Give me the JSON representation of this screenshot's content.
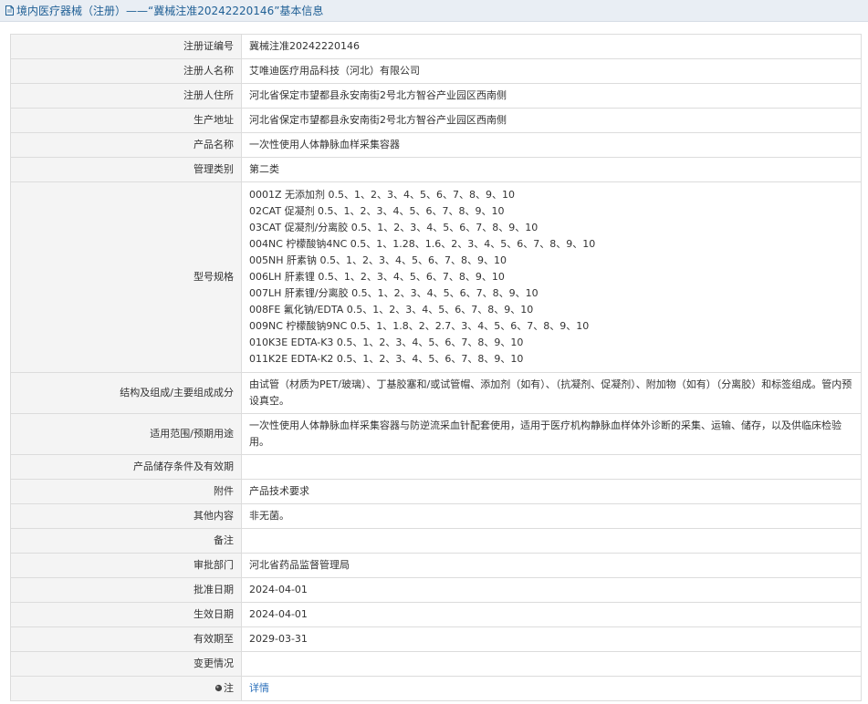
{
  "header": {
    "title": "境内医疗器械（注册）——“冀械注准20242220146”基本信息"
  },
  "rows": [
    {
      "label": "注册证编号",
      "value": "冀械注准20242220146"
    },
    {
      "label": "注册人名称",
      "value": "艾唯迪医疗用品科技（河北）有限公司"
    },
    {
      "label": "注册人住所",
      "value": "河北省保定市望都县永安南街2号北方智谷产业园区西南侧"
    },
    {
      "label": "生产地址",
      "value": "河北省保定市望都县永安南街2号北方智谷产业园区西南侧"
    },
    {
      "label": "产品名称",
      "value": "一次性使用人体静脉血样采集容器"
    },
    {
      "label": "管理类别",
      "value": "第二类"
    }
  ],
  "model": {
    "label": "型号规格",
    "lines": [
      "0001Z 无添加剂 0.5、1、2、3、4、5、6、7、8、9、10",
      "02CAT 促凝剂 0.5、1、2、3、4、5、6、7、8、9、10",
      "03CAT 促凝剂/分离胶 0.5、1、2、3、4、5、6、7、8、9、10",
      "004NC 柠檬酸钠4NC 0.5、1、1.28、1.6、2、3、4、5、6、7、8、9、10",
      "005NH 肝素钠 0.5、1、2、3、4、5、6、7、8、9、10",
      "006LH 肝素锂 0.5、1、2、3、4、5、6、7、8、9、10",
      "007LH 肝素锂/分离胶 0.5、1、2、3、4、5、6、7、8、9、10",
      "008FE 氟化钠/EDTA 0.5、1、2、3、4、5、6、7、8、9、10",
      "009NC 柠檬酸钠9NC 0.5、1、1.8、2、2.7、3、4、5、6、7、8、9、10",
      "010K3E EDTA-K3 0.5、1、2、3、4、5、6、7、8、9、10",
      "011K2E EDTA-K2 0.5、1、2、3、4、5、6、7、8、9、10"
    ]
  },
  "structure": {
    "label": "结构及组成/主要组成成分",
    "value": "由试管（材质为PET/玻璃）、丁基胶塞和/或试管帽、添加剂（如有）、（抗凝剂、促凝剂）、附加物（如有）（分离胶）和标签组成。管内预设真空。"
  },
  "usage": {
    "label": "适用范围/预期用途",
    "value": "一次性使用人体静脉血样采集容器与防逆流采血针配套使用，适用于医疗机构静脉血样体外诊断的采集、运输、储存，以及供临床检验用。"
  },
  "rows2": [
    {
      "label": "产品储存条件及有效期",
      "value": ""
    },
    {
      "label": "附件",
      "value": "产品技术要求"
    },
    {
      "label": "其他内容",
      "value": "非无菌。"
    },
    {
      "label": "备注",
      "value": ""
    },
    {
      "label": "审批部门",
      "value": "河北省药品监督管理局"
    },
    {
      "label": "批准日期",
      "value": "2024-04-01"
    },
    {
      "label": "生效日期",
      "value": "2024-04-01"
    },
    {
      "label": "有效期至",
      "value": "2029-03-31"
    },
    {
      "label": "变更情况",
      "value": ""
    }
  ],
  "note": {
    "label": "注",
    "link_text": "详情"
  },
  "colors": {
    "header_bg": "#e9eef4",
    "header_text": "#1f5f95",
    "label_bg": "#f4f4f4",
    "border": "#dcdcdc",
    "link": "#2a6fba"
  }
}
